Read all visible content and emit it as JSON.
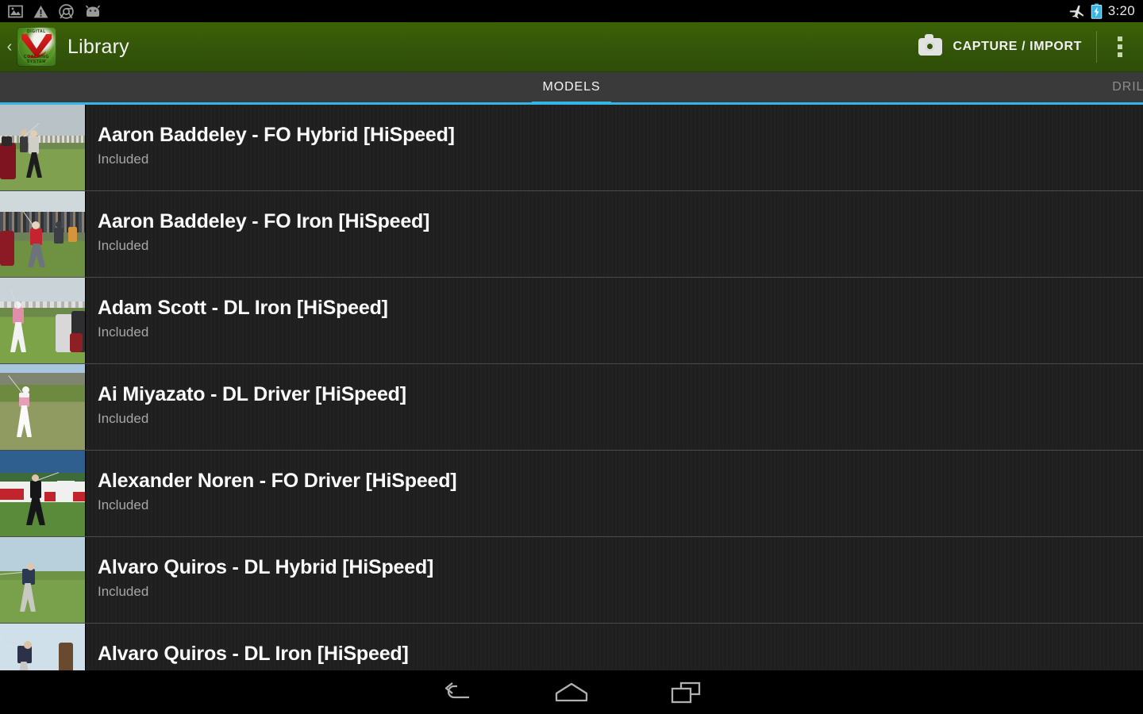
{
  "status_bar": {
    "icons_left": [
      "image-icon",
      "warning-icon",
      "chrome-icon",
      "android-bug-icon"
    ],
    "icons_right": [
      "airplane-mode-icon",
      "battery-charging-icon"
    ],
    "time": "3:20"
  },
  "action_bar": {
    "back_chevron": "‹",
    "logo_alt": "digital-coaching-system-logo",
    "logo_text_top": "DIGITAL",
    "logo_text_bottom": "COACHING SYSTEM",
    "title": "Library",
    "capture_label": "CAPTURE / IMPORT",
    "capture_icon": "camera-icon",
    "overflow_icon": "overflow-menu-icon",
    "background_color": "#33550a"
  },
  "tabs": {
    "active_index": 0,
    "indicator_color": "#33b5e5",
    "items": [
      {
        "label": "MODELS",
        "active": true
      },
      {
        "label": "DRILLS",
        "active": false
      }
    ]
  },
  "list": {
    "rows": [
      {
        "title": "Aaron Baddeley - FO Hybrid [HiSpeed]",
        "subtitle": "Included",
        "thumb": "golfer-gray-shirt-fairway"
      },
      {
        "title": "Aaron Baddeley - FO Iron [HiSpeed]",
        "subtitle": "Included",
        "thumb": "golfer-red-shirt-range"
      },
      {
        "title": "Adam Scott - DL Iron [HiSpeed]",
        "subtitle": "Included",
        "thumb": "golfer-pink-shirt-green"
      },
      {
        "title": "Ai Miyazato - DL Driver [HiSpeed]",
        "subtitle": "Included",
        "thumb": "golfer-pink-white-hills"
      },
      {
        "title": "Alexander Noren - FO Driver [HiSpeed]",
        "subtitle": "Included",
        "thumb": "golfer-black-outfit-tee-10"
      },
      {
        "title": "Alvaro Quiros - DL Hybrid [HiSpeed]",
        "subtitle": "Included",
        "thumb": "golfer-navy-shirt-range"
      },
      {
        "title": "Alvaro Quiros - DL Iron [HiSpeed]",
        "subtitle": "",
        "thumb": "golfer-navy-shirt-field"
      }
    ]
  },
  "nav_bar": {
    "buttons": [
      {
        "icon": "back-icon"
      },
      {
        "icon": "home-icon"
      },
      {
        "icon": "recents-icon"
      }
    ]
  }
}
